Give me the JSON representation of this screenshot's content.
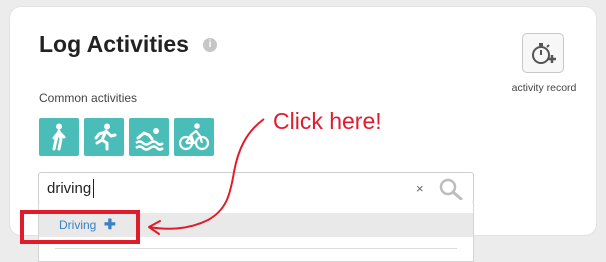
{
  "header": {
    "title": "Log Activities",
    "info_glyph": "i"
  },
  "common": {
    "label": "Common activities",
    "activities": [
      {
        "icon": "walking-icon"
      },
      {
        "icon": "running-icon"
      },
      {
        "icon": "swimming-icon"
      },
      {
        "icon": "cycling-icon"
      }
    ]
  },
  "record": {
    "label": "activity record",
    "icon": "stopwatch-plus-icon"
  },
  "search": {
    "value": "driving",
    "clear_glyph": "×"
  },
  "dropdown": {
    "items": [
      {
        "label": "Driving",
        "plus_glyph": "✚"
      }
    ]
  },
  "annotation": {
    "callout": "Click here!",
    "color": "#e01c2c"
  },
  "colors": {
    "activity_tile": "#4bbdb9",
    "link": "#3b7fc4"
  }
}
